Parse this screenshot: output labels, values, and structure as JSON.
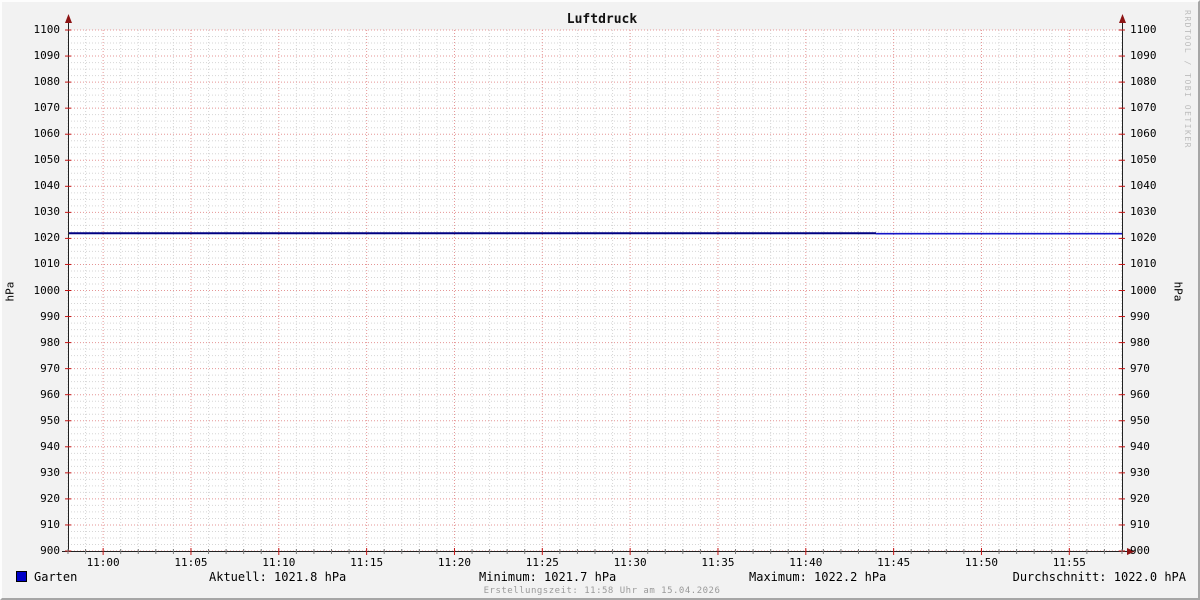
{
  "title": "Luftdruck",
  "watermark": "RRDTOOL / TOBI OETIKER",
  "axis_units": {
    "left": "hPa",
    "right": "hPa"
  },
  "legend": {
    "series_label": "Garten",
    "series_color": "#0000c8",
    "stats": {
      "aktuell": "Aktuell: 1021.8 hPa",
      "minimum": "Minimum: 1021.7 hPa",
      "maximum": "Maximum: 1022.2 hPa",
      "durchschnitt": "Durchschnitt: 1022.0 hPA"
    }
  },
  "footer": {
    "creation_text": "Erstellungszeit: 11:58 Uhr am 15.04.2026"
  },
  "chart_data": {
    "type": "line",
    "title": "Luftdruck",
    "xlabel": "",
    "ylabel": "hPa",
    "ylim": [
      900,
      1100
    ],
    "y_tick_step": 10,
    "y_minor_step": 2.5,
    "x_start": "10:58",
    "x_end": "11:58",
    "x_tick_interval_min": 5,
    "x_minor_interval_min": 1,
    "grid": true,
    "y_ticks": [
      900,
      910,
      920,
      930,
      940,
      950,
      960,
      970,
      980,
      990,
      1000,
      1010,
      1020,
      1030,
      1040,
      1050,
      1060,
      1070,
      1080,
      1090,
      1100
    ],
    "x_ticks": [
      "11:00",
      "11:05",
      "11:10",
      "11:15",
      "11:20",
      "11:25",
      "11:30",
      "11:35",
      "11:40",
      "11:45",
      "11:50",
      "11:55"
    ],
    "series": [
      {
        "name": "Garten",
        "segments": [
          {
            "t1": "10:58",
            "t2": "11:44",
            "v": 1022.0,
            "color": "#000082",
            "width": 2
          },
          {
            "t1": "11:44",
            "t2": "11:58",
            "v": 1021.8,
            "color": "#1414c8",
            "width": 1.6
          }
        ]
      }
    ],
    "stats": {
      "current_hpa": 1021.8,
      "min_hpa": 1021.7,
      "max_hpa": 1022.2,
      "avg_hpa": 1022.0
    },
    "colors": {
      "plot_bg": "#ffffff",
      "grid_major": "#e59595",
      "grid_minor": "#d6d6d6",
      "axis": "#222222",
      "arrow": "#8d1414",
      "tick_major": "#c41414",
      "tick_minor": "#7a7a7a"
    }
  }
}
